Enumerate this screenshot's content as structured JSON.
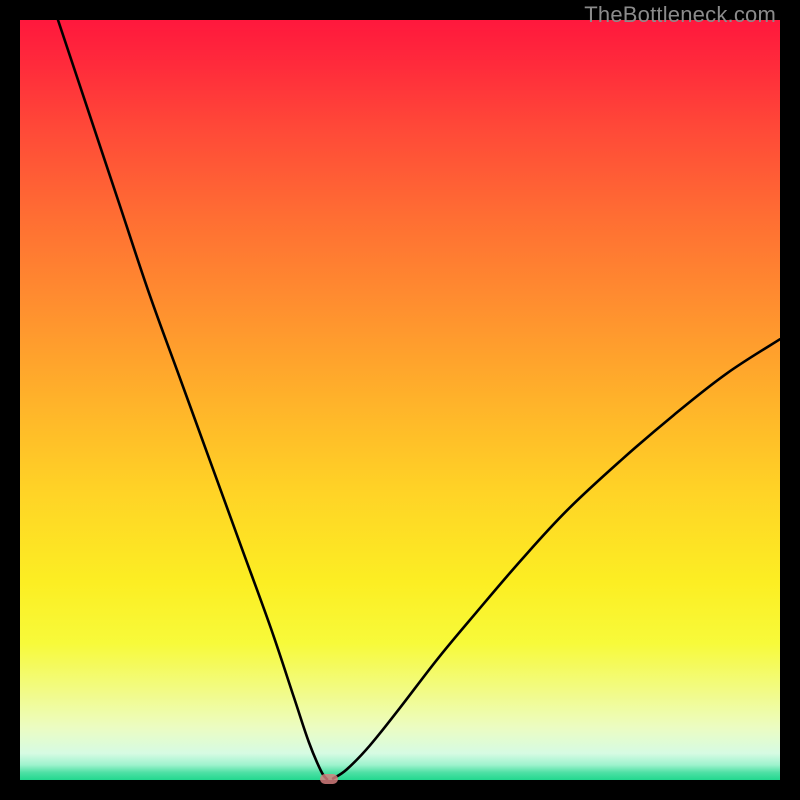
{
  "watermark": "TheBottleneck.com",
  "colors": {
    "black": "#000000",
    "gradient_top": "#ff183d",
    "gradient_mid": "#ffb22a",
    "gradient_bottom": "#22d88e",
    "curve": "#000000",
    "marker": "#d98080"
  },
  "chart_data": {
    "type": "line",
    "title": "",
    "xlabel": "",
    "ylabel": "",
    "xlim": [
      0,
      100
    ],
    "ylim": [
      0,
      100
    ],
    "note": "Piecewise shape: steep descent from top-left to a minimum near x≈40, then rise to right edge near y≈58. Background gradient maps y-value to color (high=red, low=green).",
    "series": [
      {
        "name": "curve-left",
        "x": [
          5,
          9,
          13,
          17,
          21,
          25,
          29,
          33,
          36,
          38,
          39.6,
          40.4
        ],
        "y": [
          100,
          88,
          76,
          64,
          53,
          42,
          31,
          20,
          11,
          5,
          1.2,
          0.1
        ]
      },
      {
        "name": "curve-right",
        "x": [
          41.2,
          43,
          46,
          50,
          55,
          60,
          66,
          72,
          79,
          86,
          93,
          100
        ],
        "y": [
          0.2,
          1.4,
          4.5,
          9.5,
          16,
          22,
          29,
          35.5,
          42,
          48,
          53.5,
          58
        ]
      }
    ],
    "marker": {
      "x": 40.6,
      "y": 0.1
    }
  }
}
